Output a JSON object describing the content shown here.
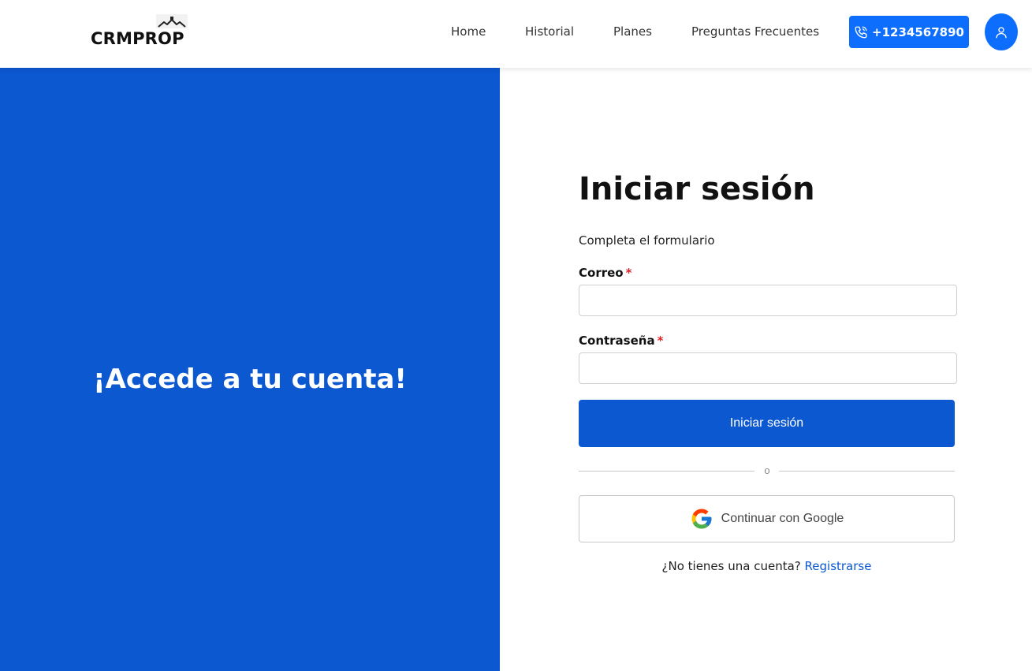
{
  "brand": {
    "logo_text": "CRMPROP",
    "logo_icon": "house-roof-icon"
  },
  "nav": {
    "items": [
      {
        "label": "Home"
      },
      {
        "label": "Historial"
      },
      {
        "label": "Planes"
      },
      {
        "label": "Preguntas Frecuentes"
      }
    ],
    "phone_label": "+1234567890",
    "phone_icon": "phone-icon",
    "user_icon": "user-icon"
  },
  "hero": {
    "title": "¡Accede a tu cuenta!"
  },
  "form": {
    "title": "Iniciar sesión",
    "subtitle": "Completa el formulario",
    "email_label": "Correo",
    "email_value": "",
    "password_label": "Contraseña",
    "password_value": "",
    "required_mark": "*",
    "submit_label": "Iniciar sesión",
    "divider_text": "o",
    "google_label": "Continuar con Google",
    "google_icon": "google-icon",
    "register_prompt": "¿No tienes una cuenta?",
    "register_link": "Registrarse"
  },
  "colors": {
    "primary": "#0d6efd",
    "panel_blue": "#0c58d1",
    "required": "#e02424"
  }
}
